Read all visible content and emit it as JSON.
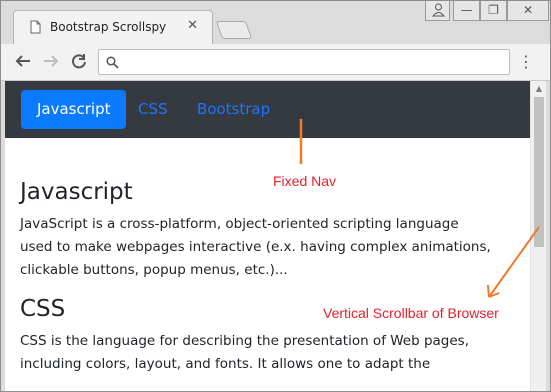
{
  "browser": {
    "tab_title": "Bootstrap Scrollspy",
    "close_glyph": "✕",
    "address_value": "",
    "menu_glyph": "⋮",
    "window_controls": [
      "⊿",
      "—",
      "❐",
      "✕"
    ]
  },
  "navbar": {
    "links": [
      {
        "label": "Javascript",
        "active": true
      },
      {
        "label": "CSS",
        "active": false
      },
      {
        "label": "Bootstrap",
        "active": false
      }
    ]
  },
  "sections": [
    {
      "heading": "Javascript",
      "lines": [
        "JavaScript is a cross-platform, object-oriented scripting language",
        "used to make webpages interactive (e.x. having complex animations,",
        "clickable buttons, popup menus, etc.)..."
      ]
    },
    {
      "heading": "CSS",
      "lines": [
        "CSS is the language for describing the presentation of Web pages,",
        "including colors, layout, and fonts. It allows one to adapt the"
      ]
    }
  ],
  "annotations": {
    "fixed_nav": "Fixed Nav",
    "scrollbar": "Vertical Scrollbar of Browser"
  },
  "colors": {
    "navbar_bg": "#343a40",
    "active_link_bg": "#0a7bff",
    "link": "#1e74ff",
    "annotation_text": "#e8202a",
    "annotation_arrow": "#f07a2a"
  }
}
